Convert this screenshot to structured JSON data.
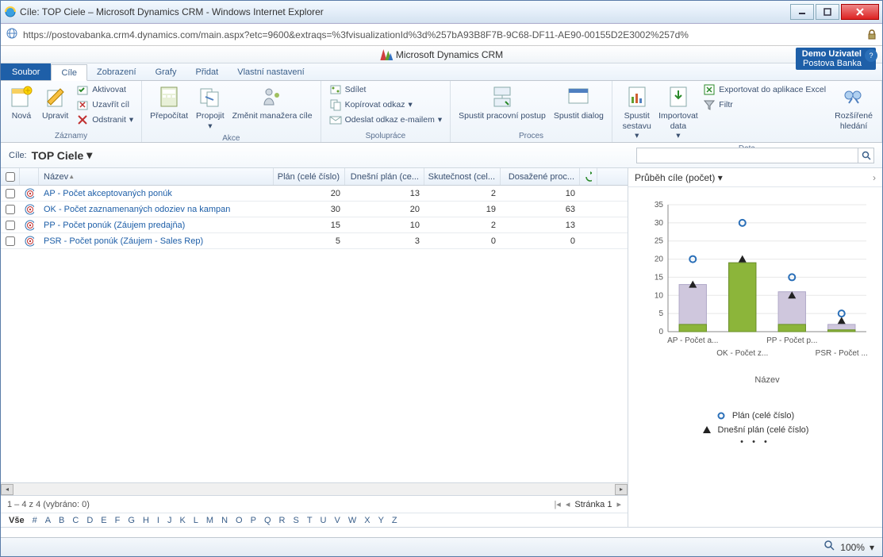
{
  "window": {
    "title": "Cíle: TOP Ciele – Microsoft Dynamics CRM - Windows Internet Explorer",
    "url": "https://postovabanka.crm4.dynamics.com/main.aspx?etc=9600&extraqs=%3fvisualizationId%3d%257bA93B8F7B-9C68-DF11-AE90-00155D2E3002%257d%"
  },
  "header": {
    "product": "Microsoft Dynamics CRM",
    "user_line1": "Demo Uzivatel",
    "user_line2": "Postova Banka"
  },
  "menu": {
    "file": "Soubor",
    "tabs": [
      "Cíle",
      "Zobrazení",
      "Grafy",
      "Přidat",
      "Vlastní nastavení"
    ],
    "active": 0
  },
  "ribbon": {
    "groups": {
      "zaznamy": {
        "label": "Záznamy",
        "nova": "Nová",
        "upravit": "Upravit",
        "aktivovat": "Aktivovat",
        "uzavrit": "Uzavřít cíl",
        "odstranit": "Odstranit"
      },
      "akce": {
        "label": "Akce",
        "prepocitat": "Přepočítat",
        "propojit": "Propojit",
        "zmenit": "Změnit manažera cíle"
      },
      "spoluprace": {
        "label": "Spolupráce",
        "sdilet": "Sdílet",
        "kopirovat": "Kopírovat odkaz",
        "odeslat": "Odeslat odkaz e-mailem"
      },
      "proces": {
        "label": "Proces",
        "postup": "Spustit pracovní postup",
        "dialog": "Spustit dialog"
      },
      "data": {
        "label": "Data",
        "sestava": "Spustit sestavu",
        "import": "Importovat data",
        "excel": "Exportovat do aplikace Excel",
        "filtr": "Filtr",
        "hledani": "Rozšířené hledání"
      }
    }
  },
  "view": {
    "label": "Cíle:",
    "name": "TOP Ciele"
  },
  "grid": {
    "columns": {
      "name": "Název",
      "c1": "Plán (celé číslo)",
      "c2": "Dnešní plán (ce...",
      "c3": "Skutečnost (cel...",
      "c4": "Dosažené proc..."
    },
    "rows": [
      {
        "name": "AP - Počet akceptovaných ponúk",
        "c1": 20,
        "c2": 13,
        "c3": 2,
        "c4": 10
      },
      {
        "name": "OK - Počet zaznamenaných odoziev na kampan",
        "c1": 30,
        "c2": 20,
        "c3": 19,
        "c4": 63
      },
      {
        "name": "PP - Počet ponúk (Záujem predajňa)",
        "c1": 15,
        "c2": 10,
        "c3": 2,
        "c4": 13
      },
      {
        "name": "PSR - Počet ponúk (Záujem - Sales Rep)",
        "c1": 5,
        "c2": 3,
        "c3": 0,
        "c4": 0
      }
    ],
    "footer": "1 – 4  z 4 (vybráno: 0)",
    "page_label": "Stránka 1",
    "alpha_all": "Vše",
    "alpha": [
      "#",
      "A",
      "B",
      "C",
      "D",
      "E",
      "F",
      "G",
      "H",
      "I",
      "J",
      "K",
      "L",
      "M",
      "N",
      "O",
      "P",
      "Q",
      "R",
      "S",
      "T",
      "U",
      "V",
      "W",
      "X",
      "Y",
      "Z"
    ]
  },
  "chart": {
    "title": "Průběh cíle (počet)",
    "xlabel": "Název",
    "legend": {
      "plan": "Plán (celé číslo)",
      "today": "Dnešní plán (celé číslo)"
    }
  },
  "chart_data": {
    "type": "bar",
    "categories": [
      "AP - Počet a...",
      "OK - Počet z...",
      "PP - Počet p...",
      "PSR - Počet ..."
    ],
    "series": [
      {
        "name": "Plán (celé číslo)",
        "kind": "circle",
        "values": [
          20,
          30,
          15,
          5
        ]
      },
      {
        "name": "Dnešní plán (celé číslo)",
        "kind": "triangle",
        "values": [
          13,
          20,
          10,
          3
        ]
      },
      {
        "name": "bar_light",
        "kind": "bar",
        "color": "#cfc7dd",
        "values": [
          13,
          19,
          11,
          2
        ]
      },
      {
        "name": "bar_green",
        "kind": "bar",
        "color": "#8cb53a",
        "values": [
          2,
          19,
          2,
          0.5
        ]
      }
    ],
    "ylim": [
      0,
      35
    ],
    "yticks": [
      0,
      5,
      10,
      15,
      20,
      25,
      30,
      35
    ],
    "xlabel": "Název"
  },
  "status": {
    "zoom": "100%"
  }
}
